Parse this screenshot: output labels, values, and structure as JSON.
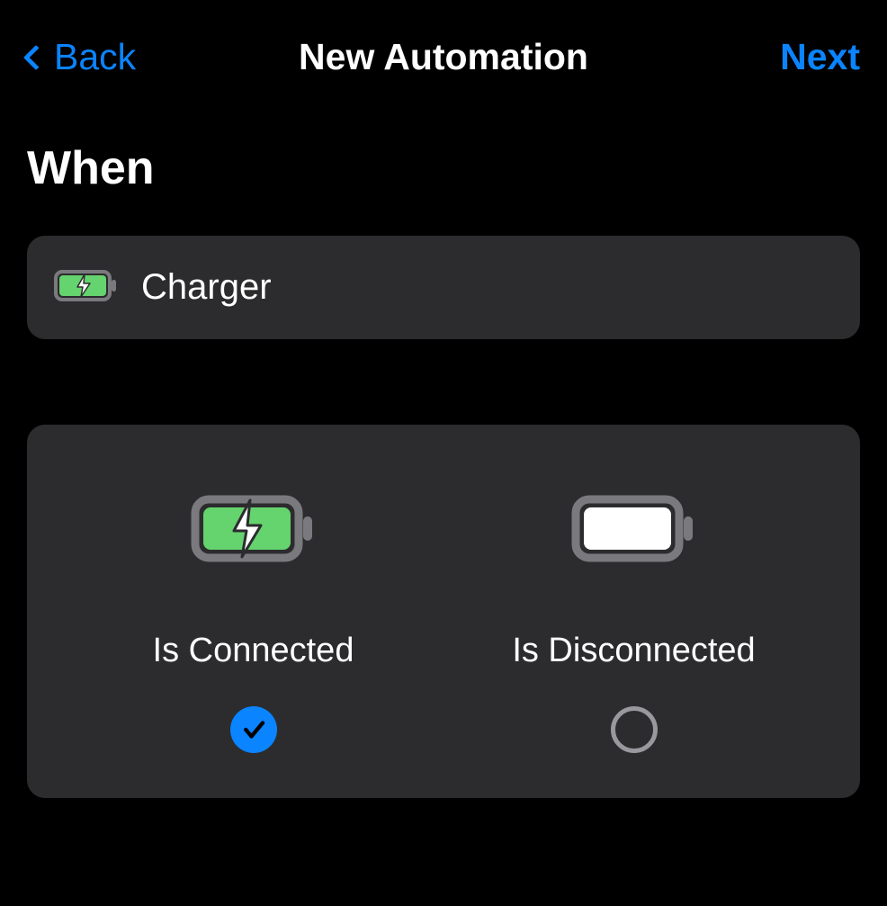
{
  "nav": {
    "back_label": "Back",
    "title": "New Automation",
    "next_label": "Next"
  },
  "section": {
    "title": "When"
  },
  "trigger": {
    "label": "Charger"
  },
  "options": {
    "connected": {
      "label": "Is Connected",
      "selected": true
    },
    "disconnected": {
      "label": "Is Disconnected",
      "selected": false
    }
  }
}
